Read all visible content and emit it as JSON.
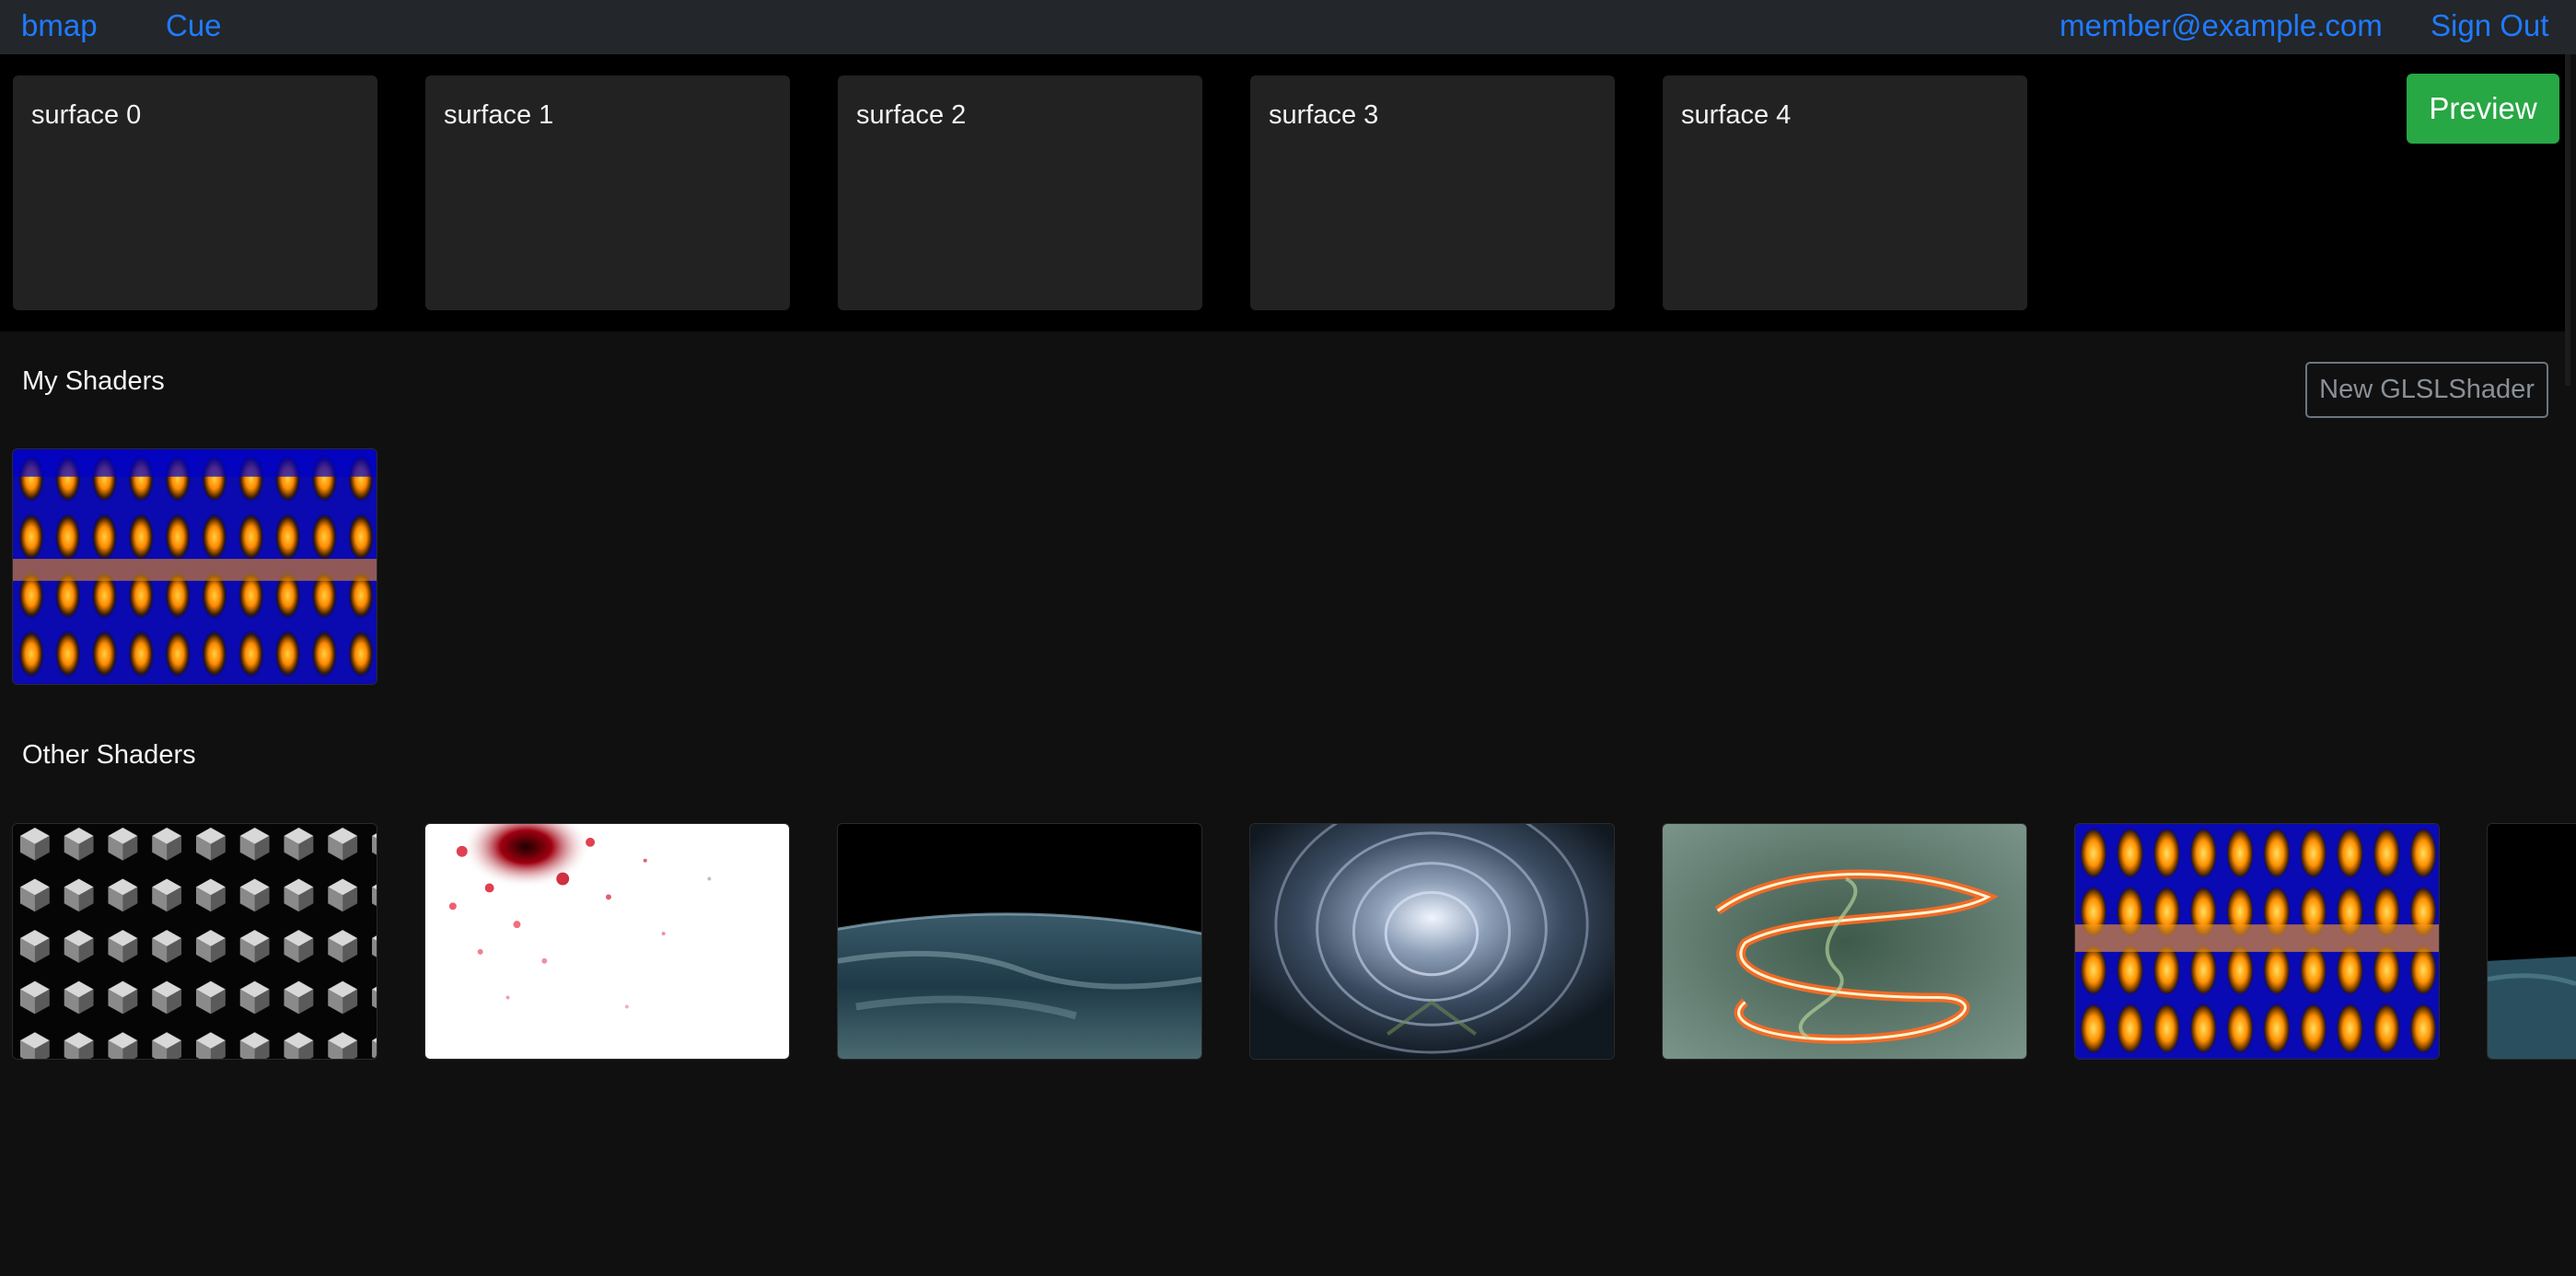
{
  "nav": {
    "brand": "bmap",
    "cue": "Cue",
    "user_email": "member@example.com",
    "sign_out": "Sign Out"
  },
  "surfaces": [
    {
      "label": "surface 0"
    },
    {
      "label": "surface 1"
    },
    {
      "label": "surface 2"
    },
    {
      "label": "surface 3"
    },
    {
      "label": "surface 4"
    }
  ],
  "preview_label": "Preview",
  "my_shaders": {
    "title": "My Shaders",
    "new_button": "New GLSLShader",
    "items": [
      {
        "thumbnail": "blue-orange-wave-pattern"
      }
    ]
  },
  "other_shaders": {
    "title": "Other Shaders",
    "items": [
      {
        "thumbnail": "grey-cubes-pattern"
      },
      {
        "thumbnail": "red-particle-burst"
      },
      {
        "thumbnail": "earth-horizon"
      },
      {
        "thumbnail": "fractal-tunnel"
      },
      {
        "thumbnail": "glowing-spiral-trail"
      },
      {
        "thumbnail": "blue-orange-wave-pattern"
      },
      {
        "thumbnail": "partial-dark-thumbnail"
      }
    ]
  },
  "colors": {
    "navbar_bg": "#23262b",
    "link": "#1f7bff",
    "preview_button": "#28a745",
    "page_bg": "#101010",
    "surface_card": "#222222"
  }
}
